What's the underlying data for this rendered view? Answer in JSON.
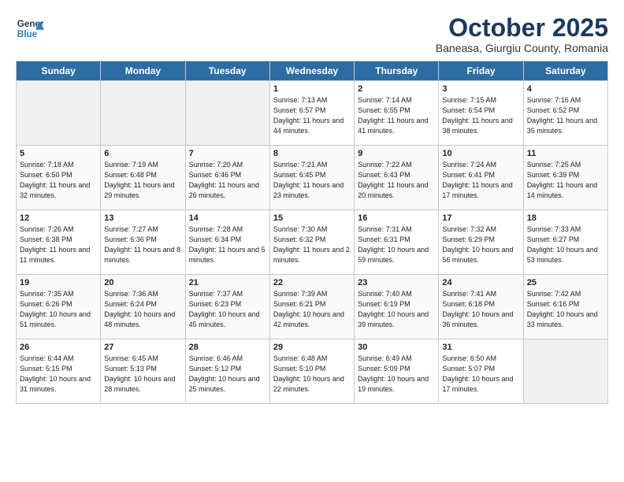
{
  "header": {
    "logo_line1": "General",
    "logo_line2": "Blue",
    "month": "October 2025",
    "location": "Baneasa, Giurgiu County, Romania"
  },
  "weekdays": [
    "Sunday",
    "Monday",
    "Tuesday",
    "Wednesday",
    "Thursday",
    "Friday",
    "Saturday"
  ],
  "weeks": [
    [
      {
        "day": "",
        "info": ""
      },
      {
        "day": "",
        "info": ""
      },
      {
        "day": "",
        "info": ""
      },
      {
        "day": "1",
        "info": "Sunrise: 7:13 AM\nSunset: 6:57 PM\nDaylight: 11 hours\nand 44 minutes."
      },
      {
        "day": "2",
        "info": "Sunrise: 7:14 AM\nSunset: 6:55 PM\nDaylight: 11 hours\nand 41 minutes."
      },
      {
        "day": "3",
        "info": "Sunrise: 7:15 AM\nSunset: 6:54 PM\nDaylight: 11 hours\nand 38 minutes."
      },
      {
        "day": "4",
        "info": "Sunrise: 7:16 AM\nSunset: 6:52 PM\nDaylight: 11 hours\nand 35 minutes."
      }
    ],
    [
      {
        "day": "5",
        "info": "Sunrise: 7:18 AM\nSunset: 6:50 PM\nDaylight: 11 hours\nand 32 minutes."
      },
      {
        "day": "6",
        "info": "Sunrise: 7:19 AM\nSunset: 6:48 PM\nDaylight: 11 hours\nand 29 minutes."
      },
      {
        "day": "7",
        "info": "Sunrise: 7:20 AM\nSunset: 6:46 PM\nDaylight: 11 hours\nand 26 minutes."
      },
      {
        "day": "8",
        "info": "Sunrise: 7:21 AM\nSunset: 6:45 PM\nDaylight: 11 hours\nand 23 minutes."
      },
      {
        "day": "9",
        "info": "Sunrise: 7:22 AM\nSunset: 6:43 PM\nDaylight: 11 hours\nand 20 minutes."
      },
      {
        "day": "10",
        "info": "Sunrise: 7:24 AM\nSunset: 6:41 PM\nDaylight: 11 hours\nand 17 minutes."
      },
      {
        "day": "11",
        "info": "Sunrise: 7:25 AM\nSunset: 6:39 PM\nDaylight: 11 hours\nand 14 minutes."
      }
    ],
    [
      {
        "day": "12",
        "info": "Sunrise: 7:26 AM\nSunset: 6:38 PM\nDaylight: 11 hours\nand 11 minutes."
      },
      {
        "day": "13",
        "info": "Sunrise: 7:27 AM\nSunset: 6:36 PM\nDaylight: 11 hours\nand 8 minutes."
      },
      {
        "day": "14",
        "info": "Sunrise: 7:28 AM\nSunset: 6:34 PM\nDaylight: 11 hours\nand 5 minutes."
      },
      {
        "day": "15",
        "info": "Sunrise: 7:30 AM\nSunset: 6:32 PM\nDaylight: 11 hours\nand 2 minutes."
      },
      {
        "day": "16",
        "info": "Sunrise: 7:31 AM\nSunset: 6:31 PM\nDaylight: 10 hours\nand 59 minutes."
      },
      {
        "day": "17",
        "info": "Sunrise: 7:32 AM\nSunset: 6:29 PM\nDaylight: 10 hours\nand 56 minutes."
      },
      {
        "day": "18",
        "info": "Sunrise: 7:33 AM\nSunset: 6:27 PM\nDaylight: 10 hours\nand 53 minutes."
      }
    ],
    [
      {
        "day": "19",
        "info": "Sunrise: 7:35 AM\nSunset: 6:26 PM\nDaylight: 10 hours\nand 51 minutes."
      },
      {
        "day": "20",
        "info": "Sunrise: 7:36 AM\nSunset: 6:24 PM\nDaylight: 10 hours\nand 48 minutes."
      },
      {
        "day": "21",
        "info": "Sunrise: 7:37 AM\nSunset: 6:23 PM\nDaylight: 10 hours\nand 45 minutes."
      },
      {
        "day": "22",
        "info": "Sunrise: 7:39 AM\nSunset: 6:21 PM\nDaylight: 10 hours\nand 42 minutes."
      },
      {
        "day": "23",
        "info": "Sunrise: 7:40 AM\nSunset: 6:19 PM\nDaylight: 10 hours\nand 39 minutes."
      },
      {
        "day": "24",
        "info": "Sunrise: 7:41 AM\nSunset: 6:18 PM\nDaylight: 10 hours\nand 36 minutes."
      },
      {
        "day": "25",
        "info": "Sunrise: 7:42 AM\nSunset: 6:16 PM\nDaylight: 10 hours\nand 33 minutes."
      }
    ],
    [
      {
        "day": "26",
        "info": "Sunrise: 6:44 AM\nSunset: 5:15 PM\nDaylight: 10 hours\nand 31 minutes."
      },
      {
        "day": "27",
        "info": "Sunrise: 6:45 AM\nSunset: 5:13 PM\nDaylight: 10 hours\nand 28 minutes."
      },
      {
        "day": "28",
        "info": "Sunrise: 6:46 AM\nSunset: 5:12 PM\nDaylight: 10 hours\nand 25 minutes."
      },
      {
        "day": "29",
        "info": "Sunrise: 6:48 AM\nSunset: 5:10 PM\nDaylight: 10 hours\nand 22 minutes."
      },
      {
        "day": "30",
        "info": "Sunrise: 6:49 AM\nSunset: 5:09 PM\nDaylight: 10 hours\nand 19 minutes."
      },
      {
        "day": "31",
        "info": "Sunrise: 6:50 AM\nSunset: 5:07 PM\nDaylight: 10 hours\nand 17 minutes."
      },
      {
        "day": "",
        "info": ""
      }
    ]
  ]
}
